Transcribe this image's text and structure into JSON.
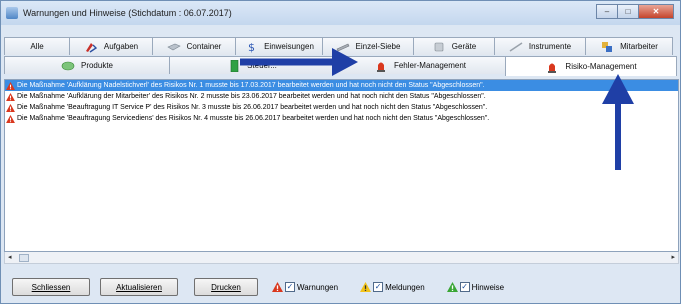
{
  "window": {
    "title": "Warnungen und Hinweise (Stichdatum : 06.07.2017)",
    "minimize_glyph": "–",
    "maximize_glyph": "□",
    "close_glyph": "✕"
  },
  "tabs_row1": [
    {
      "label": "Alle"
    },
    {
      "label": "Aufgaben",
      "icon": "aufgaben-icon"
    },
    {
      "label": "Container",
      "icon": "container-icon"
    },
    {
      "label": "Einweisungen",
      "icon": "einweisungen-icon"
    },
    {
      "label": "Einzel-Siebe",
      "icon": "einzel-siebe-icon"
    },
    {
      "label": "Geräte",
      "icon": "geraete-icon"
    },
    {
      "label": "Instrumente",
      "icon": "instrumente-icon"
    },
    {
      "label": "Mitarbeiter",
      "icon": "mitarbeiter-icon"
    }
  ],
  "tabs_row2": [
    {
      "label": "Produkte",
      "icon": "produkte-icon"
    },
    {
      "label": "Steuer...",
      "icon": "steuer-icon"
    },
    {
      "label": "Fehler-Management",
      "icon": "alarm-light-icon"
    },
    {
      "label": "Risiko-Management",
      "icon": "alarm-light-icon"
    }
  ],
  "messages": [
    "Die Maßnahme 'Aufklärung Nadelstichverl' des Risikos Nr. 1 musste bis 17.03.2017 bearbeitet werden und hat noch nicht den Status \"Abgeschlossen\".",
    "Die Maßnahme 'Aufklärung der Mitarbeiter' des Risikos Nr. 2 musste bis 23.06.2017 bearbeitet werden und hat noch nicht den Status \"Abgeschlossen\".",
    "Die Maßnahme 'Beauftragung IT Service P' des Risikos Nr. 3 musste bis 26.06.2017 bearbeitet werden und hat noch nicht den Status \"Abgeschlossen\".",
    "Die Maßnahme 'Beauftragung Servicediens' des Risikos Nr. 4 musste bis 26.06.2017 bearbeitet werden und hat noch nicht den Status \"Abgeschlossen\"."
  ],
  "scroll": {
    "left_glyph": "◂",
    "right_glyph": "▸"
  },
  "buttons": {
    "schliessen": "Schliessen",
    "aktualisieren": "Aktualisieren",
    "drucken": "Drucken"
  },
  "filters": {
    "warnungen": "Warnungen",
    "meldungen": "Meldungen",
    "hinweise": "Hinweise",
    "check_glyph": "✓"
  },
  "colors": {
    "selection": "#3b8de3",
    "annotation_arrow": "#1f3fa6",
    "warning_red": "#d9381e",
    "meldung_yellow": "#f2c318",
    "hinweis_green": "#3aa635"
  }
}
